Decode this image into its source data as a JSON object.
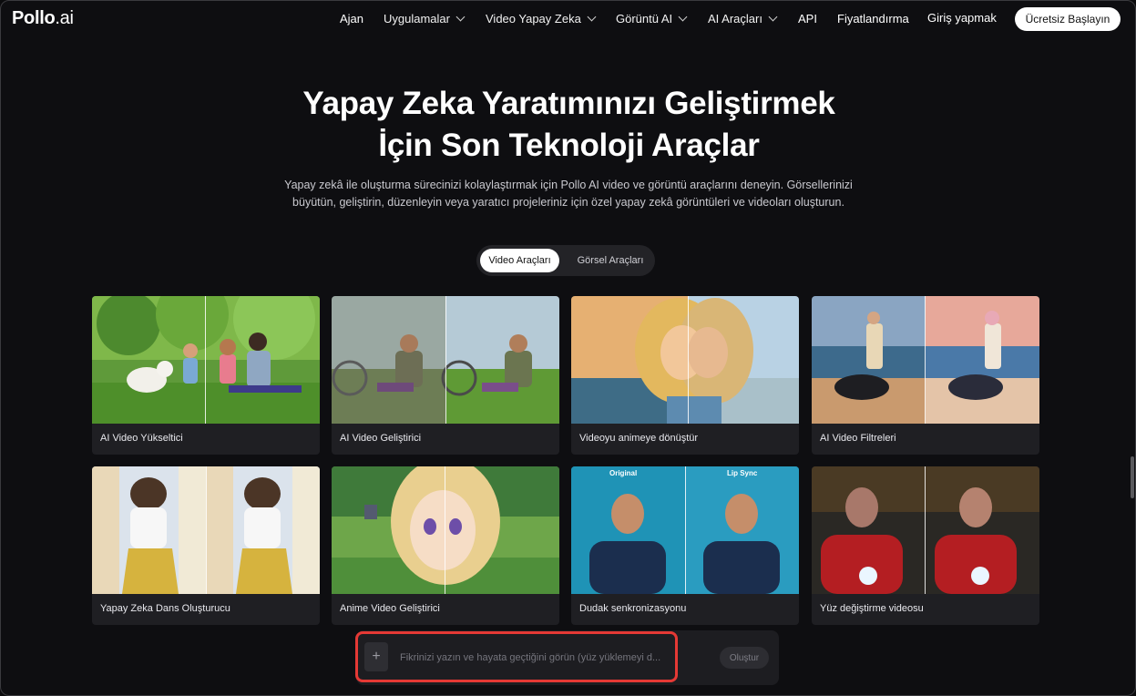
{
  "logo": {
    "main": "Pollo",
    "suffix": ".ai"
  },
  "nav": {
    "items": [
      {
        "label": "Ajan",
        "dropdown": false
      },
      {
        "label": "Uygulamalar",
        "dropdown": true
      },
      {
        "label": "Video Yapay Zeka",
        "dropdown": true
      },
      {
        "label": "Görüntü AI",
        "dropdown": true
      },
      {
        "label": "AI Araçları",
        "dropdown": true
      },
      {
        "label": "API",
        "dropdown": false
      },
      {
        "label": "Fiyatlandırma",
        "dropdown": false
      },
      {
        "label": "Giriş yapmak",
        "dropdown": false
      }
    ],
    "cta": "Ücretsiz Başlayın"
  },
  "hero": {
    "title_line1": "Yapay Zeka Yaratımınızı Geliştirmek",
    "title_line2": "İçin Son Teknoloji Araçlar",
    "subtitle": "Yapay zekâ ile oluşturma sürecinizi kolaylaştırmak için Pollo AI video ve görüntü araçlarını deneyin. Görsellerinizi büyütün, geliştirin, düzenleyin veya yaratıcı projeleriniz için özel yapay zekâ görüntüleri ve videoları oluşturun."
  },
  "tabs": {
    "active": "Video Araçları",
    "inactive": "Görsel Araçları"
  },
  "cards": [
    {
      "label": "AI Video Yükseltici"
    },
    {
      "label": "AI Video Geliştirici"
    },
    {
      "label": "Videoyu animeye dönüştür"
    },
    {
      "label": "AI Video Filtreleri"
    },
    {
      "label": "Yapay Zeka Dans Oluşturucu"
    },
    {
      "label": "Anime Video Geliştirici"
    },
    {
      "label": "Dudak senkronizasyonu",
      "overlay_left": "Original",
      "overlay_right": "Lip Sync"
    },
    {
      "label": "Yüz değiştirme videosu"
    }
  ],
  "prompt": {
    "placeholder": "Fikrinizi yazın ve hayata geçtiğini görün (yüz yüklemeyi d...",
    "button": "Oluştur",
    "plus": "+"
  },
  "colors": {
    "highlight": "#e53935",
    "background": "#0e0e11",
    "card": "#1f1f23"
  }
}
